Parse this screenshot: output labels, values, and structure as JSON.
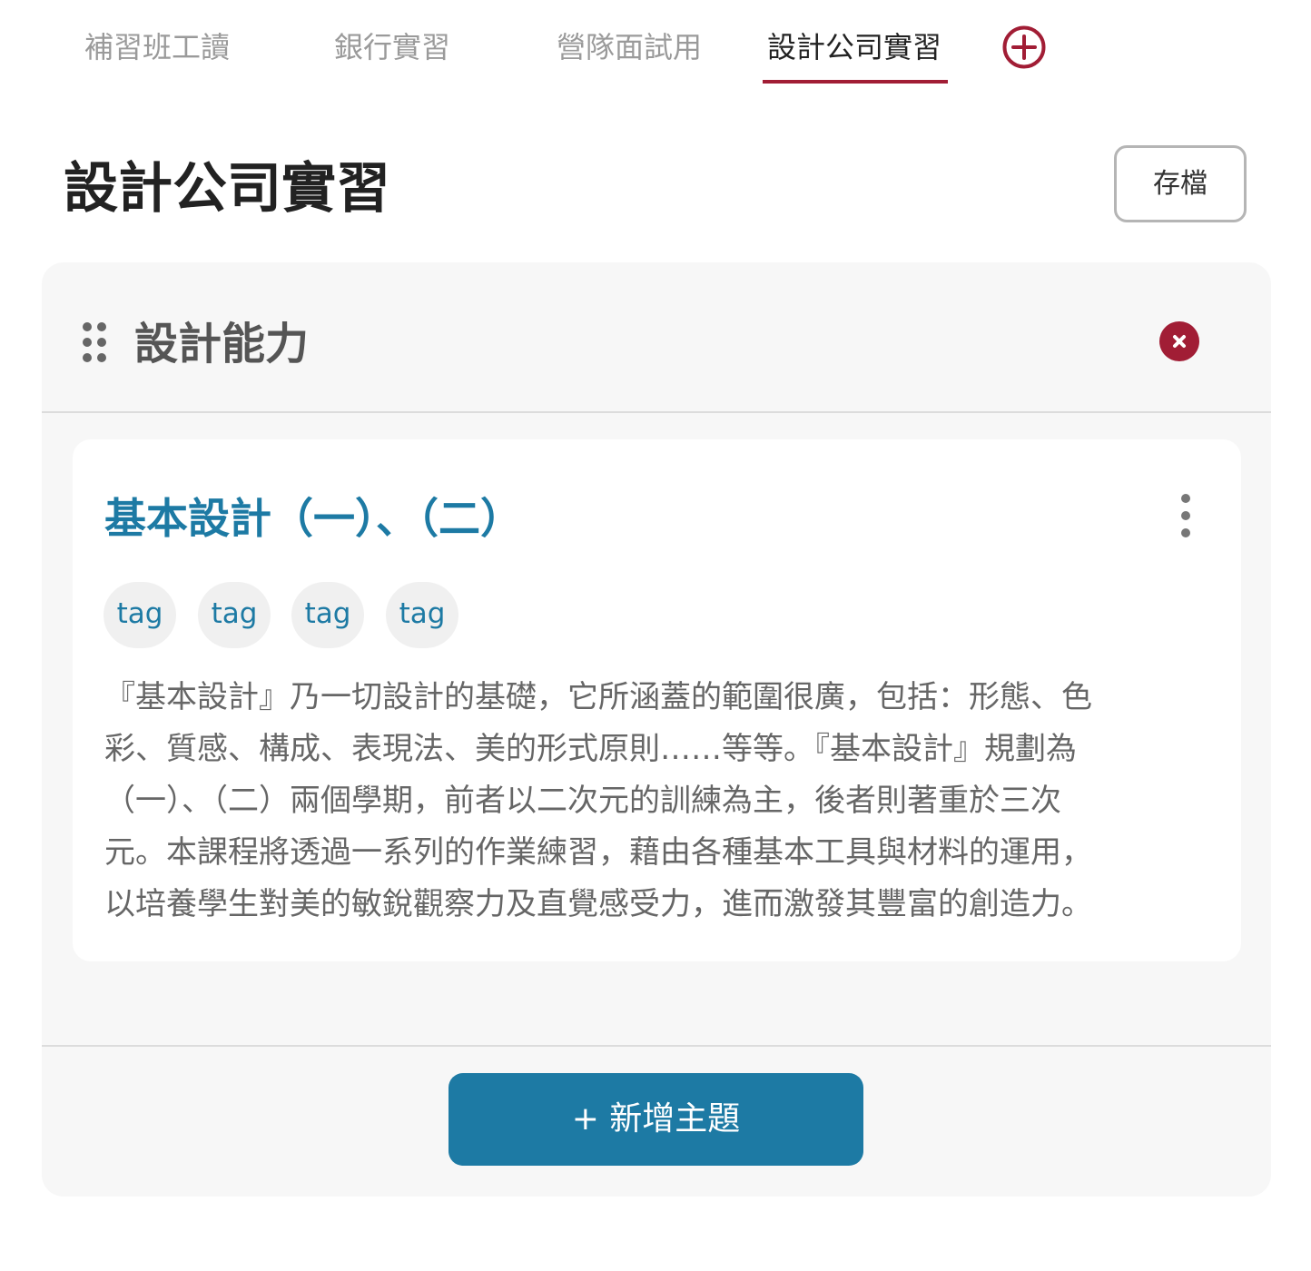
{
  "tabs": [
    {
      "label": "補習班工讀",
      "active": false
    },
    {
      "label": "銀行實習",
      "active": false
    },
    {
      "label": "營隊面試用",
      "active": false
    },
    {
      "label": "設計公司實習",
      "active": true
    }
  ],
  "add_tab_icon": "plus-circle-icon",
  "header": {
    "title": "設計公司實習",
    "save_label": "存檔"
  },
  "section": {
    "title": "設計能力",
    "drag_icon": "drag-handle-icon",
    "close_icon": "close-icon"
  },
  "topic": {
    "title": "基本設計（一）、（二）",
    "more_icon": "more-vertical-icon",
    "tags": [
      "tag",
      "tag",
      "tag",
      "tag"
    ],
    "description_lines": [
      "『基本設計』乃一切設計的基礎，它所涵蓋的範圍很廣，包括：形態、色",
      "彩、質感、構成、表現法、美的形式原則……等等。『基本設計』規劃為",
      "（一）、（二）兩個學期，前者以二次元的訓練為主，後者則著重於三次",
      "元。本課程將透過一系列的作業練習，藉由各種基本工具與材料的運用，",
      "以培養學生對美的敏銳觀察力及直覺感受力，進而激發其豐富的創造力。"
    ]
  },
  "add_topic_label": "+ 新增主題",
  "colors": {
    "accent_red": "#a11d35",
    "accent_blue": "#1d7aa4",
    "panel_bg": "#f7f7f7"
  }
}
